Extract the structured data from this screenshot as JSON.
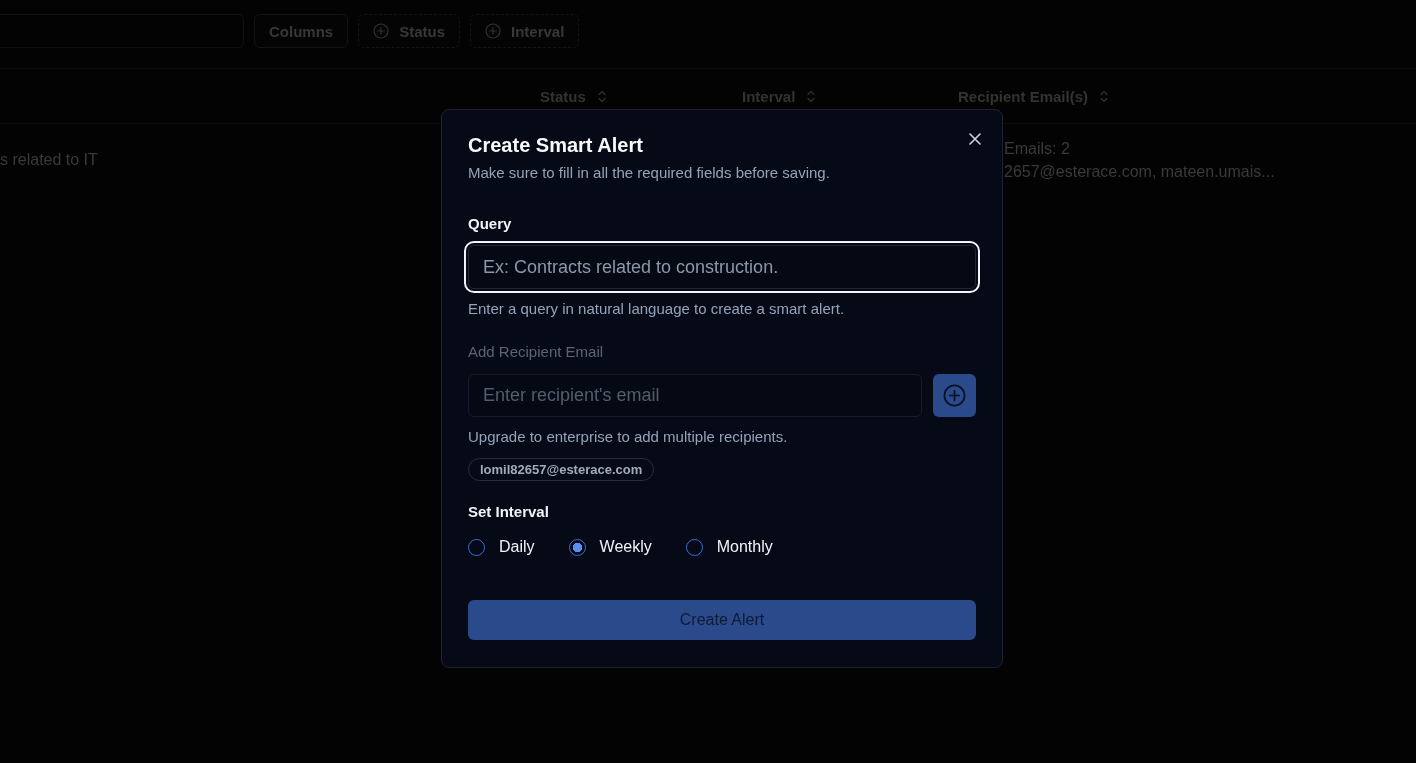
{
  "toolbar": {
    "buttons": [
      {
        "label": "Columns",
        "kind": "plain"
      },
      {
        "label": "Status",
        "kind": "filter"
      },
      {
        "label": "Interval",
        "kind": "filter"
      }
    ]
  },
  "table": {
    "columns": [
      {
        "label": "Status"
      },
      {
        "label": "Interval"
      },
      {
        "label": "Recipient Email(s)"
      }
    ],
    "rows": [
      {
        "column_1": "s related to IT",
        "recipient_emails": [
          "Emails: 2",
          "2657@esterace.com, mateen.umais..."
        ]
      }
    ]
  },
  "dialog": {
    "title": "Create Smart Alert",
    "subtitle": "Make sure to fill in all the required fields before saving.",
    "query": {
      "label": "Query",
      "placeholder": "Ex: Contracts related to construction.",
      "focused": true,
      "helper": "Enter a query in natural language to create a smart alert."
    },
    "recipient": {
      "label": "Add Recipient Email",
      "placeholder": "Enter recipient's email",
      "disabled": true,
      "helper": "Upgrade to enterprise to add multiple recipients.",
      "emails": [
        "lomil82657@esterace.com"
      ]
    },
    "interval": {
      "label": "Set Interval",
      "options": [
        {
          "label": "Daily",
          "selected": false
        },
        {
          "label": "Weekly",
          "selected": true
        },
        {
          "label": "Monthly",
          "selected": false
        }
      ]
    },
    "submit": {
      "label": "Create Alert",
      "disabled": true
    }
  }
}
